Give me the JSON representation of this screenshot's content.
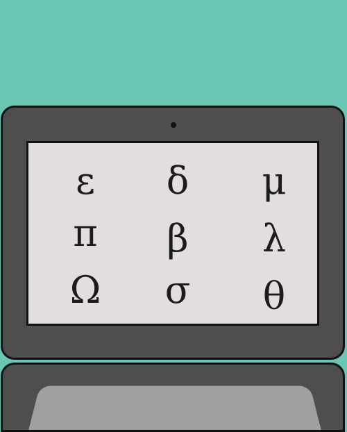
{
  "screen": {
    "glyphs": [
      "ε",
      "δ",
      "μ",
      "π",
      "β",
      "λ",
      "Ω",
      "σ",
      "θ"
    ]
  },
  "colors": {
    "background": "#6cc6b4",
    "laptop_body": "#4e4e4e",
    "screen": "#e2dede",
    "keyboard": "#a0a0a0",
    "outline": "#111111"
  },
  "icons": {
    "webcam": "webcam-icon"
  }
}
